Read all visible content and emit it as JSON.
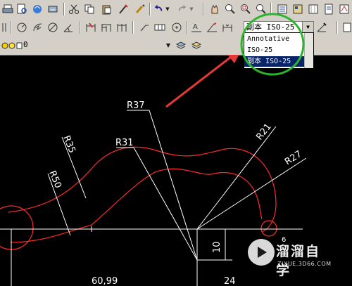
{
  "toolbar_dim": {
    "style_combo_value": "副本 ISO-25",
    "dropdown_options": [
      "Annotative",
      "ISO-25",
      "副本 ISO-25"
    ],
    "selected_index": 2
  },
  "layer_bar": {
    "layer_value": "0"
  },
  "drawing": {
    "labels": {
      "r37": "R37",
      "r31": "R31",
      "r35": "R35",
      "r50": "R50",
      "r21": "R21",
      "r27": "R27",
      "d10": "10",
      "d6099": "60,99",
      "d24": "24",
      "d6": "6"
    },
    "colors": {
      "curve": "#ff2a2a",
      "dimension": "#ffffff",
      "arrow": "#e53935",
      "highlight_circle": "#2db42d",
      "toolbar": "#d4d0c8",
      "selection": "#0a246a"
    }
  },
  "watermark": {
    "title": "溜溜自学",
    "url": "ZIXUE.3D66.COM"
  }
}
